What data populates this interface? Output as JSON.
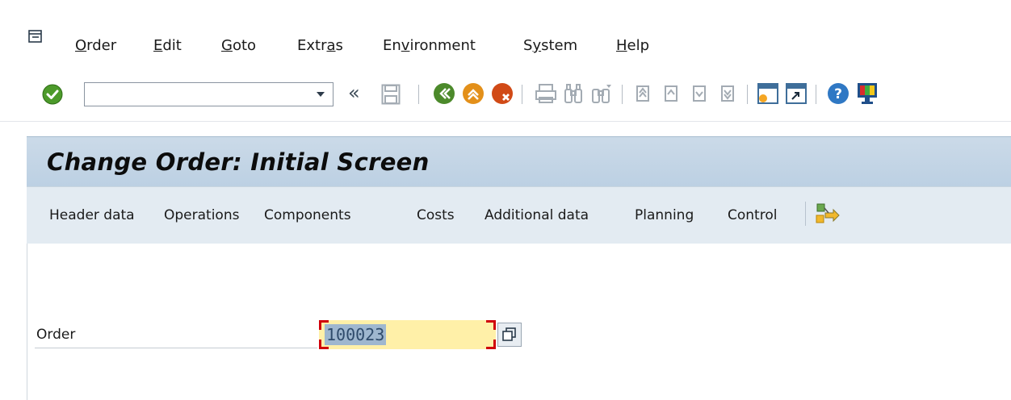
{
  "menu": {
    "items": [
      {
        "pre": "",
        "ul": "O",
        "post": "rder"
      },
      {
        "pre": "",
        "ul": "E",
        "post": "dit"
      },
      {
        "pre": "",
        "ul": "G",
        "post": "oto"
      },
      {
        "pre": "Extr",
        "ul": "a",
        "post": "s"
      },
      {
        "pre": "En",
        "ul": "v",
        "post": "ironment"
      },
      {
        "pre": "S",
        "ul": "y",
        "post": "stem"
      },
      {
        "pre": "",
        "ul": "H",
        "post": "elp"
      }
    ]
  },
  "toolbar": {
    "command_value": "",
    "icons": [
      "enter-icon",
      "command-dropdown-icon",
      "collapse-chevron-icon",
      "save-icon",
      "back-icon",
      "exit-icon",
      "cancel-icon",
      "print-icon",
      "find-icon",
      "find-next-icon",
      "first-page-icon",
      "previous-page-icon",
      "next-page-icon",
      "last-page-icon",
      "create-session-icon",
      "shortcut-icon",
      "help-icon",
      "customize-layout-icon"
    ]
  },
  "page": {
    "title": "Change Order: Initial Screen"
  },
  "app_toolbar": {
    "items": [
      "Header data",
      "Operations",
      "Components",
      "Costs",
      "Additional data",
      "Planning",
      "Control"
    ]
  },
  "form": {
    "order_label": "Order",
    "order_value": "100023"
  },
  "colors": {
    "title_bar": "#c4d6e7",
    "app_toolbar": "#e3ebf2",
    "input_highlight": "#fff0a8",
    "required_marker": "#d0000a"
  }
}
